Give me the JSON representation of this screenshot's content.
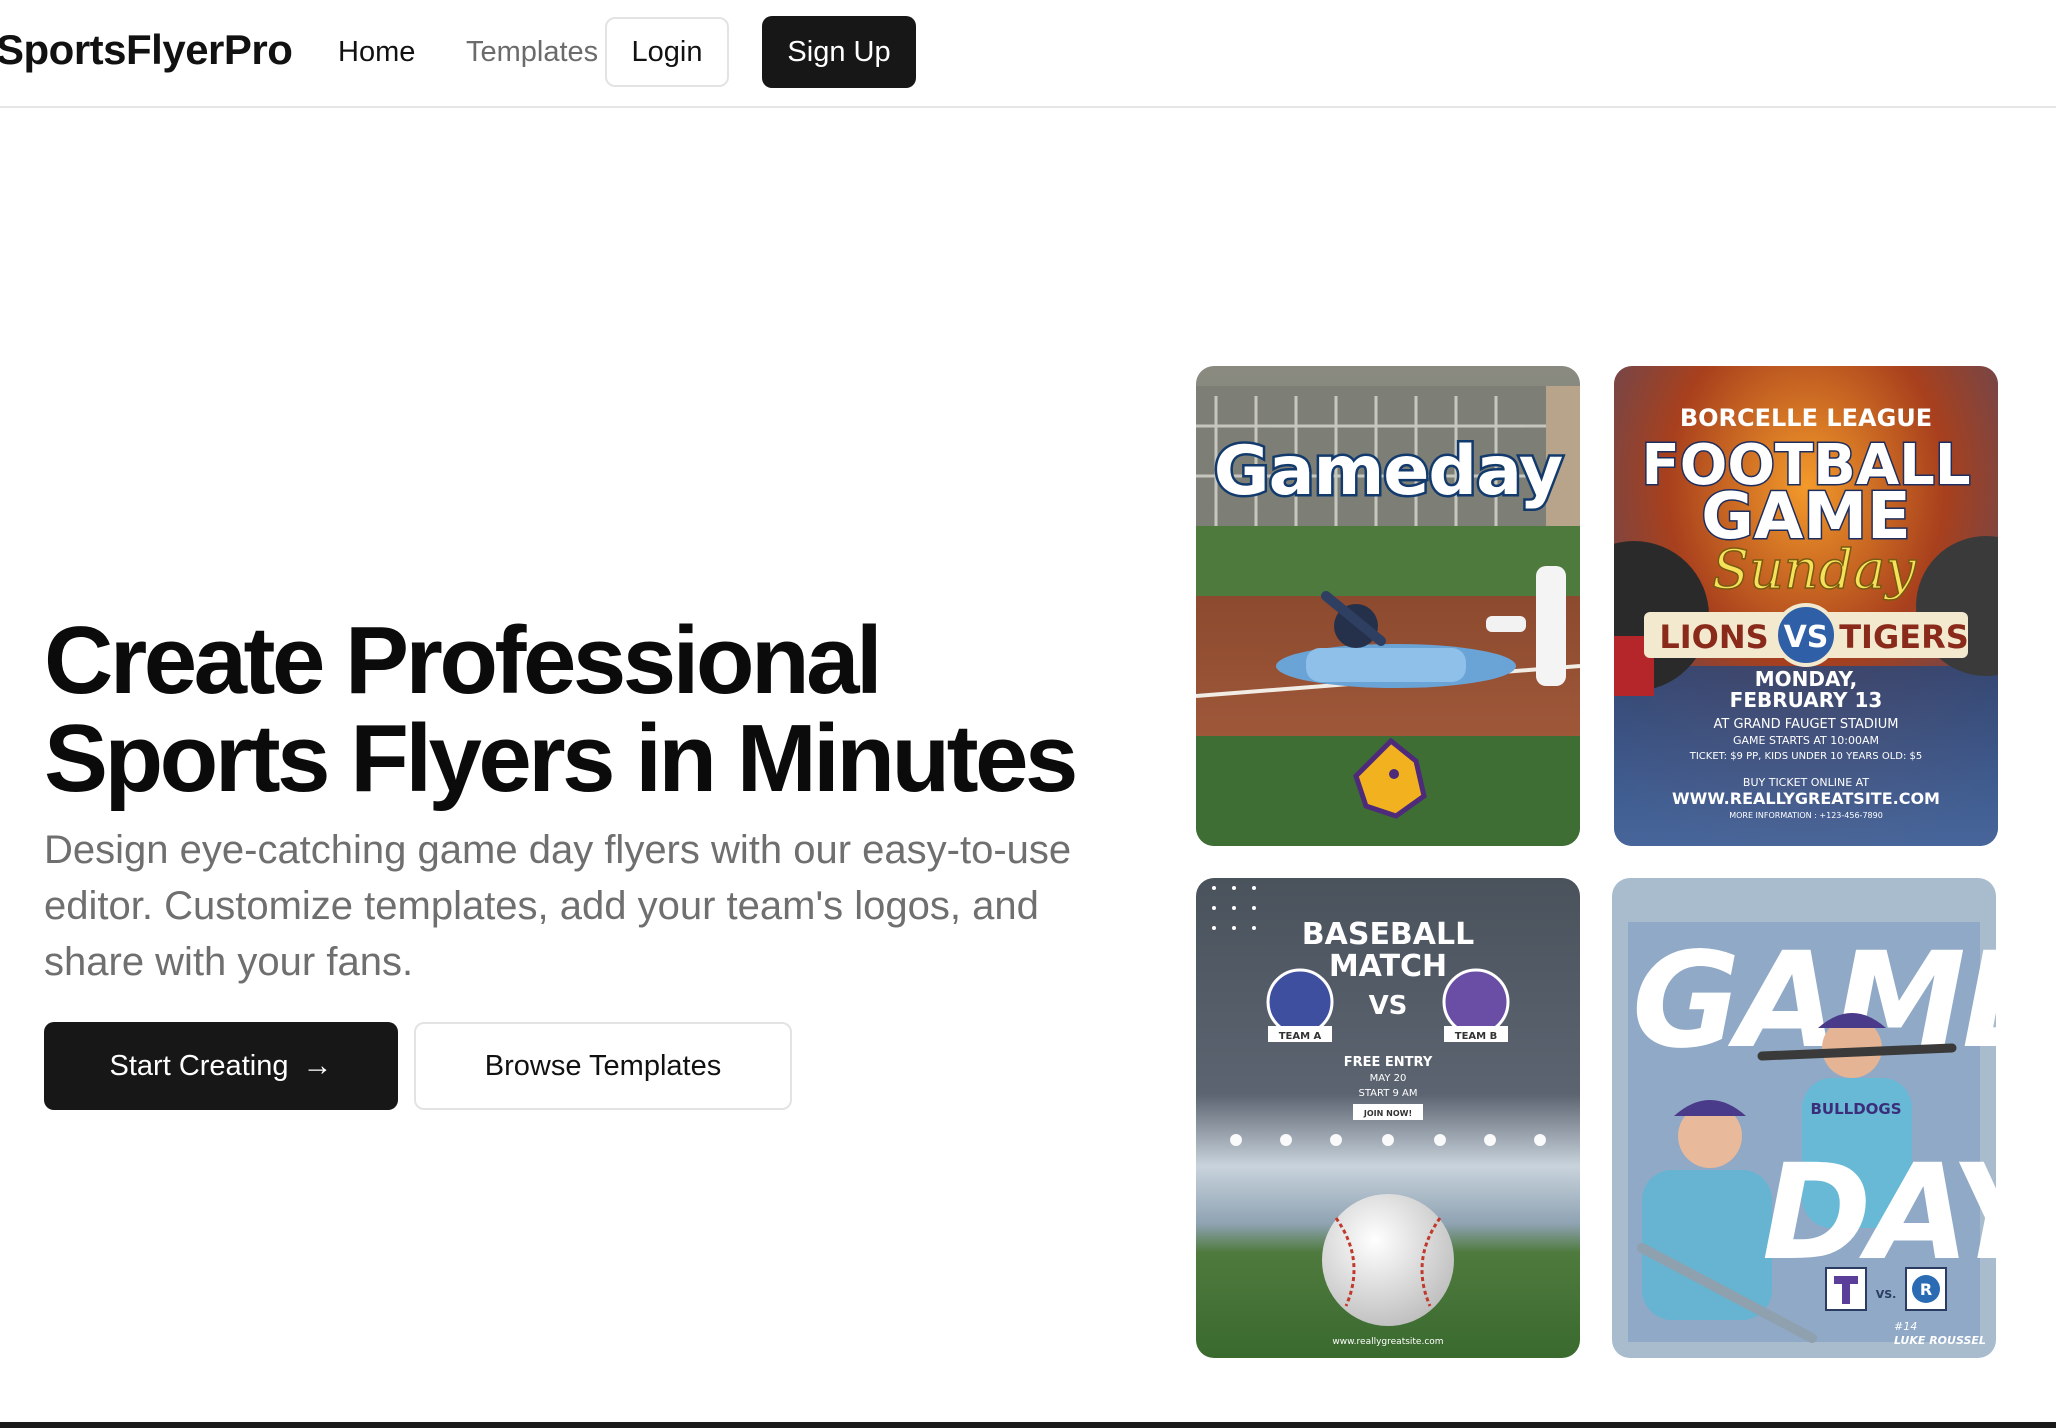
{
  "nav": {
    "brand": "SportsFlyerPro",
    "links": [
      {
        "label": "Home"
      },
      {
        "label": "Templates"
      }
    ],
    "login_label": "Login",
    "signup_label": "Sign Up"
  },
  "hero": {
    "title_line1": "Create Professional",
    "title_line2": "Sports Flyers in Minutes",
    "subtitle": "Design eye-catching game day flyers with our easy-to-use editor. Customize templates, add your team's logos, and share with your fans.",
    "primary_cta": "Start Creating",
    "secondary_cta": "Browse Templates"
  },
  "flyers": {
    "gameday": {
      "title": "Gameday"
    },
    "football": {
      "league": "BORCELLE LEAGUE",
      "title1": "FOOTBALL",
      "title2": "GAME",
      "script": "Sunday",
      "team1": "LIONS",
      "vs": "VS",
      "team2": "TIGERS",
      "date1": "MONDAY,",
      "date2": "FEBRUARY 13",
      "venue": "AT GRAND FAUGET STADIUM",
      "time": "GAME STARTS AT 10:00AM",
      "ticket": "TICKET: $9 PP, KIDS UNDER 10 YEARS OLD: $5",
      "buy": "BUY TICKET ONLINE AT",
      "site": "WWW.REALLYGREATSITE.COM",
      "info": "MORE INFORMATION : +123-456-7890"
    },
    "baseball": {
      "title1": "BASEBALL",
      "title2": "MATCH",
      "vs": "VS",
      "team_a": "TEAM A",
      "team_b": "TEAM B",
      "entry": "FREE ENTRY",
      "date": "MAY 20",
      "start": "START 9 AM",
      "join": "JOIN NOW!",
      "site": "www.reallygreatsite.com"
    },
    "gameday2": {
      "word1": "GAME",
      "word2": "DAY",
      "jersey": "BULLDOGS",
      "vs": "VS.",
      "player_no": "#14",
      "player_name": "LUKE ROUSSEL"
    }
  },
  "colors": {
    "primary": "#171717",
    "muted_text": "#6f6f6f",
    "border": "#e3e3e3"
  }
}
